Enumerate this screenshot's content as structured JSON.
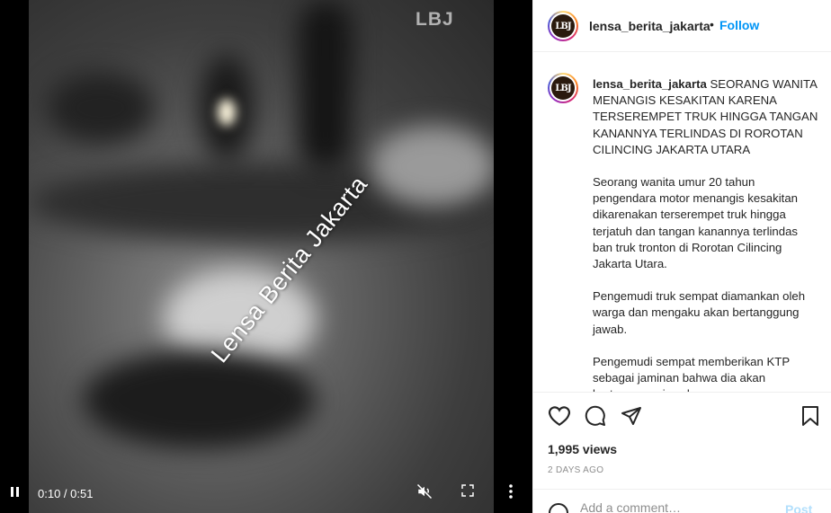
{
  "video": {
    "corner_mark": "LBJ",
    "watermark": "Lensa Berita Jakarta",
    "time": "0:10 / 0:51",
    "icons": {
      "play_pause": "pause-icon",
      "mute": "muted-speaker-icon",
      "fullscreen": "fullscreen-icon",
      "more": "more-vertical-icon"
    }
  },
  "header": {
    "avatar_text": "LBJ",
    "username": "lensa_berita_jakarta",
    "separator": "•",
    "follow_label": "Follow"
  },
  "caption": {
    "username": "lensa_berita_jakarta",
    "headline": "SEORANG WANITA MENANGIS KESAKITAN KARENA TERSEREMPET TRUK HINGGA TANGAN KANANNYA TERLINDAS DI ROROTAN CILINCING JAKARTA UTARA",
    "paragraphs": [
      "Seorang wanita umur 20 tahun pengendara motor menangis kesakitan dikarenakan terserempet truk hingga terjatuh dan tangan kanannya terlindas ban truk tronton di Rorotan Cilincing Jakarta Utara.",
      "Pengemudi truk sempat diamankan oleh warga dan mengaku akan bertanggung jawab.",
      "Pengemudi sempat memberikan KTP sebagai jaminan bahwa dia akan bertanggung jawab."
    ]
  },
  "actions": {
    "icons": [
      "heart-icon",
      "comment-icon",
      "share-icon",
      "bookmark-icon"
    ],
    "views": "1,995 views",
    "posted": "2 DAYS AGO"
  },
  "comment": {
    "placeholder": "Add a comment…",
    "post_label": "Post"
  },
  "colors": {
    "accent": "#0095f6",
    "text": "#262626",
    "muted": "#8e8e8e"
  }
}
